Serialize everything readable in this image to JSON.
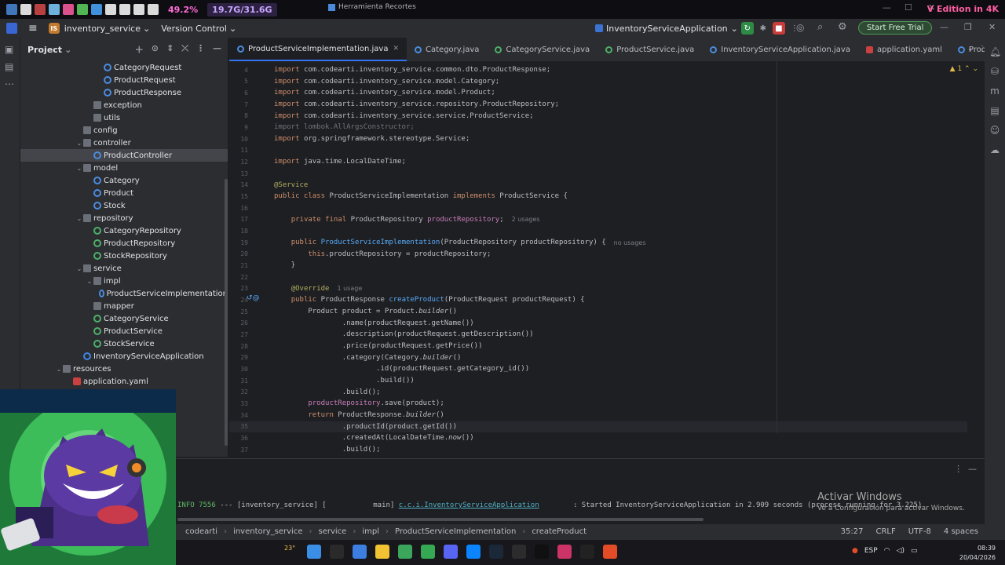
{
  "os_bar": {
    "cpu_percent": "49.2%",
    "memory": "19.7G/31.6G",
    "snip_tool": "Herramienta Recortes",
    "edition_banner": "V Edition in 4K",
    "icon_colors": [
      "#4a8ad8",
      "#ffffff",
      "#d84a4a",
      "#7fd0ff",
      "#ff5ea1",
      "#5fd35f",
      "#4aa8ff",
      "#ffffff",
      "#ffffff",
      "#ffffff",
      "#ffffff"
    ]
  },
  "ide_header": {
    "project_badge": "IS",
    "project_name": "inventory_service",
    "vcs_label": "Version Control",
    "run_config": "InventoryServiceApplication",
    "trial_button": "Start Free Trial"
  },
  "project_panel": {
    "title": "Project",
    "tree": [
      {
        "label": "CategoryRequest",
        "depth": 8,
        "icon": "cls"
      },
      {
        "label": "ProductRequest",
        "depth": 8,
        "icon": "cls"
      },
      {
        "label": "ProductResponse",
        "depth": 8,
        "icon": "cls"
      },
      {
        "label": "exception",
        "depth": 7,
        "icon": "folder"
      },
      {
        "label": "utils",
        "depth": 7,
        "icon": "folder"
      },
      {
        "label": "config",
        "depth": 6,
        "icon": "folder"
      },
      {
        "label": "controller",
        "depth": 6,
        "icon": "folder",
        "expanded": true
      },
      {
        "label": "ProductController",
        "depth": 7,
        "icon": "cls",
        "selected": true
      },
      {
        "label": "model",
        "depth": 6,
        "icon": "folder",
        "expanded": true
      },
      {
        "label": "Category",
        "depth": 7,
        "icon": "cls"
      },
      {
        "label": "Product",
        "depth": 7,
        "icon": "cls"
      },
      {
        "label": "Stock",
        "depth": 7,
        "icon": "cls"
      },
      {
        "label": "repository",
        "depth": 6,
        "icon": "folder",
        "expanded": true
      },
      {
        "label": "CategoryRepository",
        "depth": 7,
        "icon": "intf"
      },
      {
        "label": "ProductRepository",
        "depth": 7,
        "icon": "intf"
      },
      {
        "label": "StockRepository",
        "depth": 7,
        "icon": "intf"
      },
      {
        "label": "service",
        "depth": 6,
        "icon": "folder",
        "expanded": true
      },
      {
        "label": "impl",
        "depth": 7,
        "icon": "folder",
        "expanded": true
      },
      {
        "label": "ProductServiceImplementation",
        "depth": 8,
        "icon": "cls"
      },
      {
        "label": "mapper",
        "depth": 7,
        "icon": "folder"
      },
      {
        "label": "CategoryService",
        "depth": 7,
        "icon": "intf"
      },
      {
        "label": "ProductService",
        "depth": 7,
        "icon": "intf"
      },
      {
        "label": "StockService",
        "depth": 7,
        "icon": "intf"
      },
      {
        "label": "InventoryServiceApplication",
        "depth": 6,
        "icon": "app"
      },
      {
        "label": "resources",
        "depth": 4,
        "icon": "folder",
        "expanded": true
      },
      {
        "label": "application.yaml",
        "depth": 5,
        "icon": "yaml"
      }
    ]
  },
  "editor": {
    "tabs": [
      {
        "label": "ProductServiceImplementation.java",
        "active": true,
        "icon": "cls"
      },
      {
        "label": "Category.java",
        "icon": "cls"
      },
      {
        "label": "CategoryService.java",
        "icon": "intf"
      },
      {
        "label": "ProductService.java",
        "icon": "intf"
      },
      {
        "label": "InventoryServiceApplication.java",
        "icon": "cls"
      },
      {
        "label": "application.yaml",
        "icon": "yaml"
      },
      {
        "label": "ProductRequest.java",
        "icon": "cls"
      }
    ],
    "warning_count": "1",
    "lines": [
      {
        "n": "4",
        "segs": [
          [
            "kw",
            "import"
          ],
          [
            "",
            "com.codearti.inventory_service.common.dto.ProductResponse;"
          ]
        ]
      },
      {
        "n": "5",
        "segs": [
          [
            "kw",
            "import"
          ],
          [
            "",
            "com.codearti.inventory_service.model.Category;"
          ]
        ]
      },
      {
        "n": "6",
        "segs": [
          [
            "kw",
            "import"
          ],
          [
            "",
            "com.codearti.inventory_service.model.Product;"
          ]
        ]
      },
      {
        "n": "7",
        "segs": [
          [
            "kw",
            "import"
          ],
          [
            "",
            "com.codearti.inventory_service.repository.ProductRepository;"
          ]
        ]
      },
      {
        "n": "8",
        "segs": [
          [
            "kw",
            "import"
          ],
          [
            "",
            "com.codearti.inventory_service.service.ProductService;"
          ]
        ]
      },
      {
        "n": "9",
        "segs": [
          [
            "dim",
            "import lombok.AllArgsConstructor;"
          ]
        ]
      },
      {
        "n": "10",
        "segs": [
          [
            "kw",
            "import"
          ],
          [
            "",
            "org.springframework.stereotype.Service;"
          ]
        ]
      },
      {
        "n": "11",
        "segs": []
      },
      {
        "n": "12",
        "segs": [
          [
            "kw",
            "import"
          ],
          [
            "",
            "java.time.LocalDateTime;"
          ]
        ]
      },
      {
        "n": "13",
        "segs": []
      },
      {
        "n": "14",
        "segs": [
          [
            "an",
            "@Service"
          ]
        ]
      },
      {
        "n": "15",
        "segs": [
          [
            "kw",
            "public class"
          ],
          [
            "",
            "ProductServiceImplementation"
          ],
          [
            "kw",
            "implements"
          ],
          [
            "",
            "ProductService {"
          ]
        ]
      },
      {
        "n": "16",
        "segs": []
      },
      {
        "n": "17",
        "segs": [
          [
            "",
            "    "
          ],
          [
            "kw",
            "private final"
          ],
          [
            "",
            "ProductRepository"
          ],
          [
            "fld",
            "productRepository"
          ],
          [
            "",
            ";"
          ],
          [
            "hint",
            "2 usages"
          ]
        ]
      },
      {
        "n": "18",
        "segs": []
      },
      {
        "n": "19",
        "segs": [
          [
            "",
            "    "
          ],
          [
            "kw",
            "public"
          ],
          [
            "fn",
            "ProductServiceImplementation"
          ],
          [
            "",
            "(ProductRepository productRepository) {"
          ],
          [
            "hint",
            "no usages"
          ]
        ]
      },
      {
        "n": "20",
        "segs": [
          [
            "",
            "        "
          ],
          [
            "kw",
            "this"
          ],
          [
            "",
            ".productRepository = productRepository;"
          ]
        ]
      },
      {
        "n": "21",
        "segs": [
          [
            "",
            "    }"
          ]
        ]
      },
      {
        "n": "22",
        "segs": []
      },
      {
        "n": "23",
        "segs": [
          [
            "",
            "    "
          ],
          [
            "an",
            "@Override"
          ],
          [
            "hint",
            "1 usage"
          ]
        ]
      },
      {
        "n": "24",
        "segs": [
          [
            "",
            "    "
          ],
          [
            "kw",
            "public"
          ],
          [
            "",
            "ProductResponse"
          ],
          [
            "fn",
            "createProduct"
          ],
          [
            "",
            "(ProductRequest productRequest) {"
          ]
        ]
      },
      {
        "n": "25",
        "segs": [
          [
            "",
            "        Product product = Product."
          ],
          [
            "ital",
            "builder"
          ],
          [
            "",
            "()"
          ]
        ]
      },
      {
        "n": "26",
        "segs": [
          [
            "",
            "                .name(productRequest.getName())"
          ]
        ]
      },
      {
        "n": "27",
        "segs": [
          [
            "",
            "                .description(productRequest.getDescription())"
          ]
        ]
      },
      {
        "n": "28",
        "segs": [
          [
            "",
            "                .price(productRequest.getPrice())"
          ]
        ]
      },
      {
        "n": "29",
        "segs": [
          [
            "",
            "                .category(Category."
          ],
          [
            "ital",
            "builder"
          ],
          [
            "",
            "()"
          ]
        ]
      },
      {
        "n": "30",
        "segs": [
          [
            "",
            "                        .id(productRequest.getCategory_id())"
          ]
        ]
      },
      {
        "n": "31",
        "segs": [
          [
            "",
            "                        .build())"
          ]
        ]
      },
      {
        "n": "32",
        "segs": [
          [
            "",
            "                .build();"
          ]
        ]
      },
      {
        "n": "33",
        "segs": [
          [
            "fld",
            "        productRepository"
          ],
          [
            "",
            ".save(product);"
          ]
        ]
      },
      {
        "n": "34",
        "segs": [
          [
            "",
            "        "
          ],
          [
            "kw",
            "return"
          ],
          [
            "",
            "ProductResponse."
          ],
          [
            "ital",
            "builder"
          ],
          [
            "",
            "()"
          ]
        ]
      },
      {
        "n": "35",
        "segs": [
          [
            "",
            "                .productId(product.getId())"
          ]
        ],
        "current": true
      },
      {
        "n": "36",
        "segs": [
          [
            "",
            "                .createdAt(LocalDateTime."
          ],
          [
            "ital",
            "now"
          ],
          [
            "",
            "())"
          ]
        ]
      },
      {
        "n": "37",
        "segs": [
          [
            "",
            "                .build();"
          ]
        ]
      }
    ]
  },
  "run_log": {
    "level": "INFO 7556",
    "thread": "--- [inventory_service] [           main]",
    "logger": "c.c.i.InventoryServiceApplication",
    "message": ": Started InventoryServiceApplication in 2.909 seconds (process running for 3.225)"
  },
  "status_bar": {
    "breadcrumb": [
      "codearti",
      "inventory_service",
      "service",
      "impl",
      "ProductServiceImplementation",
      "createProduct"
    ],
    "position": "35:27",
    "line_ending": "CRLF",
    "encoding": "UTF-8",
    "indent": "4 spaces"
  },
  "windows_activation": {
    "title": "Activar Windows",
    "subtitle": "Ve a Configuración para activar Windows."
  },
  "taskbar": {
    "weather": "23°",
    "lang": "ESP",
    "time": "08:39",
    "date": "20/04/2026",
    "icon_colors": [
      "#f4c24a",
      "#3b8ee6",
      "#2a2a2a",
      "#3d7fe0",
      "#f1c232",
      "#3ba55c",
      "#34a853",
      "#5865f2",
      "#0a84ff",
      "#1b2838",
      "#2c2c2c",
      "#101010",
      "#cc3366",
      "#222222",
      "#e34c26"
    ]
  }
}
